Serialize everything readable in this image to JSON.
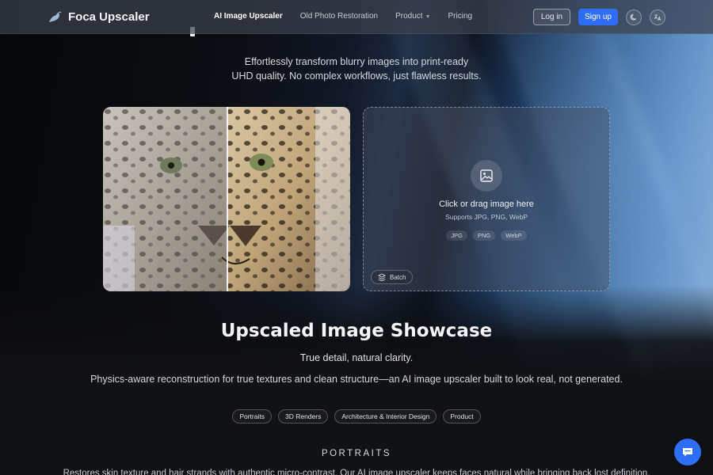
{
  "brand": {
    "name": "Foca Upscaler"
  },
  "nav": {
    "links": [
      {
        "label": "AI Image Upscaler"
      },
      {
        "label": "Old Photo Restoration"
      },
      {
        "label": "Product"
      },
      {
        "label": "Pricing"
      }
    ],
    "login_label": "Log in",
    "signup_label": "Sign up"
  },
  "hero": {
    "subtitle_line1": "Effortlessly transform blurry images into print-ready",
    "subtitle_line2": "UHD quality. No complex workflows, just flawless results."
  },
  "upload": {
    "title": "Click or drag image here",
    "supports": "Supports JPG, PNG, WebP",
    "formats": [
      "JPG",
      "PNG",
      "WebP"
    ],
    "batch_label": "Batch"
  },
  "showcase": {
    "title": "Upscaled Image Showcase",
    "tagline": "True detail, natural clarity.",
    "description": "Physics-aware reconstruction for true textures and clean structure—an AI image upscaler built to look real, not generated.",
    "categories": [
      "Portraits",
      "3D Renders",
      "Architecture & Interior Design",
      "Product"
    ],
    "section_label": "PORTRAITS",
    "section_body": "Restores skin texture and hair strands with authentic micro-contrast. Our AI image upscaler keeps faces natural while bringing back lost definition."
  },
  "colors": {
    "accent": "#2f6df6",
    "background": "#0a0b0e"
  },
  "icons": {
    "brand": "seal-logo-icon",
    "theme": "moon-icon",
    "language": "translate-icon",
    "upload": "image-icon",
    "batch": "stack-icon",
    "chat": "chat-icon"
  }
}
